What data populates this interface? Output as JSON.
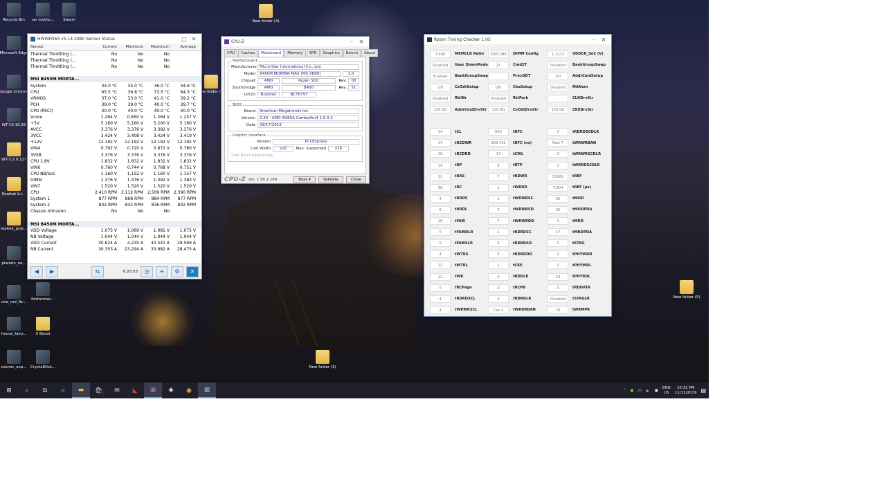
{
  "desktop": {
    "icons_left": [
      {
        "label": "Recycle Bin",
        "kind": "recycle"
      },
      {
        "label": "rar mytho...",
        "kind": "disc"
      },
      {
        "label": "Steam",
        "kind": "steam"
      },
      {
        "label": "Microsoft Edge",
        "kind": "edge"
      },
      {
        "label": "Google Chrome",
        "kind": "chrome"
      },
      {
        "label": "WT-19.10.28",
        "kind": "app"
      },
      {
        "label": "WT-3.2.0.12?",
        "kind": "folder"
      },
      {
        "label": "Realtek b.l...",
        "kind": "folder"
      },
      {
        "label": "realtek_pcie...",
        "kind": "folder"
      },
      {
        "label": "planets_ne...",
        "kind": "image"
      },
      {
        "label": "one_red_fis...",
        "kind": "image"
      },
      {
        "label": "Performan...",
        "kind": "app"
      },
      {
        "label": "house_fairy...",
        "kind": "image"
      },
      {
        "label": "X Boost",
        "kind": "folder"
      },
      {
        "label": "cosmic_exp...",
        "kind": "image"
      },
      {
        "label": "CrystalDisk...",
        "kind": "app"
      }
    ],
    "icons_misc": [
      {
        "label": "New folder (4)"
      },
      {
        "label": "New folder (3)"
      },
      {
        "label": "New folder (2)"
      },
      {
        "label": "New folder (5)"
      }
    ]
  },
  "hwinfo": {
    "title": "HWiNFO64 v5.14-2980 Sensor Status",
    "columns": [
      "Sensor",
      "Current",
      "Minimum",
      "Maximum",
      "Average"
    ],
    "rows": [
      {
        "g": false,
        "c": [
          "Thermal Throttling (...",
          "No",
          "No",
          "No",
          ""
        ]
      },
      {
        "g": false,
        "c": [
          "Thermal Throttling (...",
          "No",
          "No",
          "No",
          ""
        ]
      },
      {
        "g": false,
        "c": [
          "Thermal Throttling (...",
          "No",
          "No",
          "No",
          ""
        ]
      },
      {
        "g": false,
        "c": [
          "",
          "",
          "",
          "",
          ""
        ]
      },
      {
        "g": true,
        "c": [
          "MSI B450M MORTA...",
          "",
          "",
          "",
          ""
        ]
      },
      {
        "g": false,
        "c": [
          "System",
          "34.0 °C",
          "34.0 °C",
          "36.0 °C",
          "34.6 °C"
        ]
      },
      {
        "g": false,
        "c": [
          "CPU",
          "65.5 °C",
          "36.8 °C",
          "73.5 °C",
          "64.3 °C"
        ]
      },
      {
        "g": false,
        "c": [
          "VRMOS",
          "37.0 °C",
          "33.0 °C",
          "41.0 °C",
          "39.2 °C"
        ]
      },
      {
        "g": false,
        "c": [
          "PCH",
          "39.0 °C",
          "39.0 °C",
          "40.0 °C",
          "39.7 °C"
        ]
      },
      {
        "g": false,
        "c": [
          "CPU (PECI)",
          "40.0 °C",
          "40.0 °C",
          "40.0 °C",
          "40.0 °C"
        ]
      },
      {
        "g": false,
        "c": [
          "Vcore",
          "1.264 V",
          "0.650 V",
          "1.264 V",
          "1.257 V"
        ]
      },
      {
        "g": false,
        "c": [
          "+5V",
          "5.160 V",
          "5.160 V",
          "5.200 V",
          "5.160 V"
        ]
      },
      {
        "g": false,
        "c": [
          "AVCC",
          "3.376 V",
          "3.376 V",
          "3.392 V",
          "3.376 V"
        ]
      },
      {
        "g": false,
        "c": [
          "3VCC",
          "3.424 V",
          "3.408 V",
          "3.424 V",
          "3.419 V"
        ]
      },
      {
        "g": false,
        "c": [
          "+12V",
          "12.192 V",
          "12.192 V",
          "12.192 V",
          "12.192 V"
        ]
      },
      {
        "g": false,
        "c": [
          "VIN4",
          "0.792 V",
          "0.720 V",
          "0.872 V",
          "0.760 V"
        ]
      },
      {
        "g": false,
        "c": [
          "3VSB",
          "3.376 V",
          "3.376 V",
          "3.376 V",
          "3.376 V"
        ]
      },
      {
        "g": false,
        "c": [
          "CPU 1.8V",
          "1.832 V",
          "1.832 V",
          "1.832 V",
          "1.832 V"
        ]
      },
      {
        "g": false,
        "c": [
          "VIN6",
          "0.760 V",
          "0.744 V",
          "0.768 V",
          "0.751 V"
        ]
      },
      {
        "g": false,
        "c": [
          "CPU NB/SoC",
          "1.160 V",
          "1.152 V",
          "1.160 V",
          "1.157 V"
        ]
      },
      {
        "g": false,
        "c": [
          "DIMM",
          "1.376 V",
          "1.376 V",
          "1.392 V",
          "1.383 V"
        ]
      },
      {
        "g": false,
        "c": [
          "VIN7",
          "1.520 V",
          "1.520 V",
          "1.520 V",
          "1.520 V"
        ]
      },
      {
        "g": false,
        "c": [
          "CPU",
          "2,410 RPM",
          "2,112 RPM",
          "2,509 RPM",
          "2,390 RPM"
        ]
      },
      {
        "g": false,
        "c": [
          "System 1",
          "877 RPM",
          "868 RPM",
          "884 RPM",
          "877 RPM"
        ]
      },
      {
        "g": false,
        "c": [
          "System 2",
          "832 RPM",
          "832 RPM",
          "836 RPM",
          "832 RPM"
        ]
      },
      {
        "g": false,
        "c": [
          "Chassis Intrusion",
          "No",
          "No",
          "No",
          ""
        ]
      },
      {
        "g": false,
        "c": [
          "",
          "",
          "",
          "",
          ""
        ]
      },
      {
        "g": true,
        "c": [
          "MSI B450M MORTA...",
          "",
          "",
          "",
          ""
        ]
      },
      {
        "g": false,
        "c": [
          "VDD Voltage",
          "1.075 V",
          "1.069 V",
          "1.081 V",
          "1.075 V"
        ]
      },
      {
        "g": false,
        "c": [
          "NB Voltage",
          "1.044 V",
          "1.044 V",
          "1.044 V",
          "1.044 V"
        ]
      },
      {
        "g": false,
        "c": [
          "VDD Current",
          "30.624 A",
          "4.235 A",
          "40.541 A",
          "29.569 A"
        ]
      },
      {
        "g": false,
        "c": [
          "NB Current",
          "30.353 A",
          "23.294 A",
          "33.882 A",
          "28.475 A"
        ]
      }
    ],
    "elapsed": "0:20:53"
  },
  "cpuz": {
    "title": "CPU-Z",
    "tabs": [
      "CPU",
      "Caches",
      "Mainboard",
      "Memory",
      "SPD",
      "Graphics",
      "Bench",
      "About"
    ],
    "active_tab": "Mainboard",
    "motherboard_legend": "Motherboard",
    "manufacturer_label": "Manufacturer",
    "manufacturer": "Micro-Star International Co., Ltd.",
    "model_label": "Model",
    "model": "B450M MORTAR MAX (MS-7B89)",
    "model_rev": "1.0",
    "chipset_label": "Chipset",
    "chipset_vendor": "AMD",
    "chipset_name": "Ryzen SOC",
    "chipset_rev_label": "Rev.",
    "chipset_rev": "00",
    "southbridge_label": "Southbridge",
    "sb_vendor": "AMD",
    "sb_name": "B450",
    "sb_rev_label": "Rev.",
    "sb_rev": "51",
    "lpcio_label": "LPCIO",
    "lpcio_vendor": "Nuvoton",
    "lpcio_name": "NCT6797",
    "bios_legend": "BIOS",
    "brand_label": "Brand",
    "brand": "American Megatrends Inc.",
    "version_label": "Version",
    "version": "2.30 - AMD AGESA ComboAm4 1.0.0.3",
    "date_label": "Date",
    "date": "09/17/2019",
    "graphic_legend": "Graphic Interface",
    "gi_version_label": "Version",
    "gi_version": "PCI-Express",
    "link_width_label": "Link Width",
    "link_width": "x16",
    "max_supported_label": "Max. Supported",
    "max_supported": "x16",
    "side_band_label": "Side Band Addressing",
    "logo": "CPU-Z",
    "ver": "Ver. 1.90.1.x64",
    "tools": "Tools",
    "validate": "Validate",
    "close": "Close"
  },
  "rtc": {
    "title": "Ryzen Timing Checker 1.05",
    "columns": [
      [
        {
          "v": "3 400",
          "n": "MEMCLK Ratio"
        },
        {
          "v": "Disabled",
          "n": "Gear DownMode"
        },
        {
          "v": "Enabled",
          "n": "BankGroupSwapAlt"
        },
        {
          "v": "0/0",
          "n": "CsOdtSetup"
        },
        {
          "v": "Disabled",
          "n": "RttWr"
        },
        {
          "v": "120.0Ω",
          "n": "AddrCmdDrvStr"
        },
        {
          "v": "",
          "n": ""
        },
        {
          "v": "14",
          "n": "tCL"
        },
        {
          "v": "14",
          "n": "tRCDWR"
        },
        {
          "v": "18",
          "n": "tRCDRD"
        },
        {
          "v": "14",
          "n": "tRP"
        },
        {
          "v": "32",
          "n": "tRAS"
        },
        {
          "v": "56",
          "n": "tRC"
        },
        {
          "v": "4",
          "n": "tRRDS"
        },
        {
          "v": "6",
          "n": "tRRDL"
        },
        {
          "v": "16",
          "n": "tFAW"
        },
        {
          "v": "0",
          "n": "tFAWDLR"
        },
        {
          "v": "0",
          "n": "tFAWSLR"
        },
        {
          "v": "4",
          "n": "tWTRS"
        },
        {
          "v": "12",
          "n": "tWTRL"
        },
        {
          "v": "12",
          "n": "tWR"
        },
        {
          "v": "0",
          "n": "tRCPage"
        },
        {
          "v": "4",
          "n": "tRDRDSCL"
        },
        {
          "v": "4",
          "n": "tWRWRSCL"
        }
      ],
      [
        {
          "v": "2DPC-MR",
          "n": "DIMM Config"
        },
        {
          "v": "2T",
          "n": "Cmd2T"
        },
        {
          "v": "",
          "n": "ProcODT"
        },
        {
          "v": "0/0",
          "n": "CkeSetup"
        },
        {
          "v": "Disabled",
          "n": "RttPark"
        },
        {
          "v": "120.0Ω",
          "n": "CsOdtDrvStr"
        },
        {
          "v": "",
          "n": ""
        },
        {
          "v": "560",
          "n": "tRFC"
        },
        {
          "v": "329.412",
          "n": "tRFC (ns)"
        },
        {
          "v": "14",
          "n": "tCWL"
        },
        {
          "v": "8",
          "n": "tRTP"
        },
        {
          "v": "7",
          "n": "tRDWR"
        },
        {
          "v": "1",
          "n": "tWRRD"
        },
        {
          "v": "1",
          "n": "tWRWRSC"
        },
        {
          "v": "7",
          "n": "tWRWRSD"
        },
        {
          "v": "7",
          "n": "tWRWRDD"
        },
        {
          "v": "1",
          "n": "tRDRDSC"
        },
        {
          "v": "5",
          "n": "tRDRDSD"
        },
        {
          "v": "5",
          "n": "tRDRDDD"
        },
        {
          "v": "1",
          "n": "tCKE"
        },
        {
          "v": "0",
          "n": "tRDDLR"
        },
        {
          "v": "0",
          "n": "tRCPB"
        },
        {
          "v": "0",
          "n": "tRDRDLR"
        },
        {
          "v": "Can 2",
          "n": "tWRDRBAN"
        }
      ],
      [
        {
          "v": "1.1213",
          "n": "VDDCR_SoC (V)"
        },
        {
          "v": "Disabled",
          "n": "BankGroupSwap"
        },
        {
          "v": "3/0",
          "n": "AddrCmdSetup"
        },
        {
          "v": "Disabled",
          "n": "RttNom"
        },
        {
          "v": "",
          "n": "CLKDrvStr"
        },
        {
          "v": "120.0Ω",
          "n": "CKEDrvStr"
        },
        {
          "v": "",
          "n": ""
        },
        {
          "v": "3",
          "n": "tRDRDSCDLR"
        },
        {
          "v": "Row 7",
          "n": "tWRWRBAN"
        },
        {
          "v": "3",
          "n": "tWRWRSCDLR"
        },
        {
          "v": "3",
          "n": "tWRRDSCDLR"
        },
        {
          "v": "13260",
          "n": "tREF"
        },
        {
          "v": "7.804",
          "n": "tREF (µs)"
        },
        {
          "v": "26",
          "n": "tMOD"
        },
        {
          "v": "26",
          "n": "tMODPDA"
        },
        {
          "v": "3",
          "n": "tMRD"
        },
        {
          "v": "17",
          "n": "tMRDPDA"
        },
        {
          "v": "3",
          "n": "tSTAG"
        },
        {
          "v": "2",
          "n": "tPHYWRD"
        },
        {
          "v": "3",
          "n": "tPHYWRL"
        },
        {
          "v": "24",
          "n": "tPHYRDL"
        },
        {
          "v": "3",
          "n": "tRDDATA"
        },
        {
          "v": "Disabled",
          "n": "tSTAGLR"
        },
        {
          "v": "24",
          "n": "tWRMPR"
        }
      ]
    ]
  },
  "taskbar": {
    "lang_1": "ENG",
    "lang_2": "US",
    "time": "10:32 PM",
    "date": "11/11/2019"
  }
}
